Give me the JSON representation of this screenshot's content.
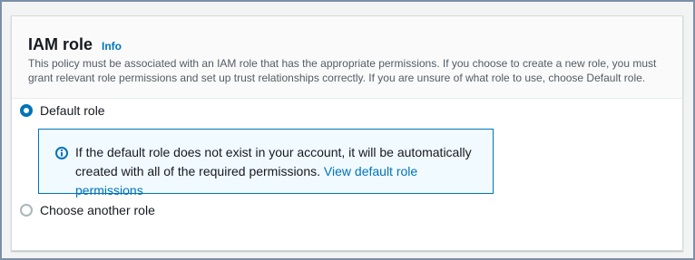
{
  "section": {
    "title": "IAM role",
    "info_label": "Info",
    "description": "This policy must be associated with an IAM role that has the appropriate permissions. If you choose to create a new role, you must grant relevant role permissions and set up trust relationships correctly. If you are unsure of what role to use, choose Default role."
  },
  "options": {
    "default_role": {
      "label": "Default role",
      "selected": true
    },
    "another_role": {
      "label": "Choose another role",
      "selected": false
    }
  },
  "alert": {
    "icon": "info-circle-icon",
    "text": "If the default role does not exist in your account, it will be automatically created with all of the required permissions.",
    "link_text": "View default role permissions"
  },
  "colors": {
    "accent": "#0073bb",
    "alert_background": "#f1faff",
    "header_background": "#fafafa"
  }
}
